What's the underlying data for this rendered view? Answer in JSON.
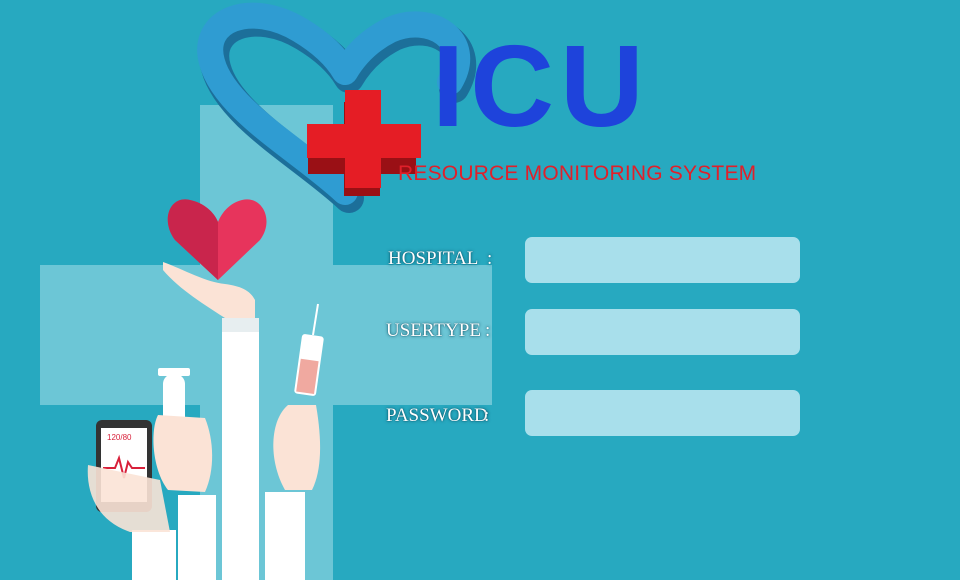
{
  "logo": {
    "title": "ICU",
    "subtitle": "RESOURCE MONITORING SYSTEM"
  },
  "form": {
    "fields": [
      {
        "label": "HOSPITAL",
        "colon": ":",
        "value": "",
        "placeholder": ""
      },
      {
        "label": "USERTYPE",
        "colon": ":",
        "value": "",
        "placeholder": ""
      },
      {
        "label": "PASSWORD",
        "colon": ":",
        "value": "",
        "placeholder": ""
      }
    ]
  },
  "illustration": {
    "phone_readout": "120/80"
  },
  "colors": {
    "background": "#27a9c0",
    "title": "#1e43db",
    "subtitle": "#e0202a",
    "input_fill": "#a8dfeb",
    "medical_cross": "#e51d25"
  }
}
